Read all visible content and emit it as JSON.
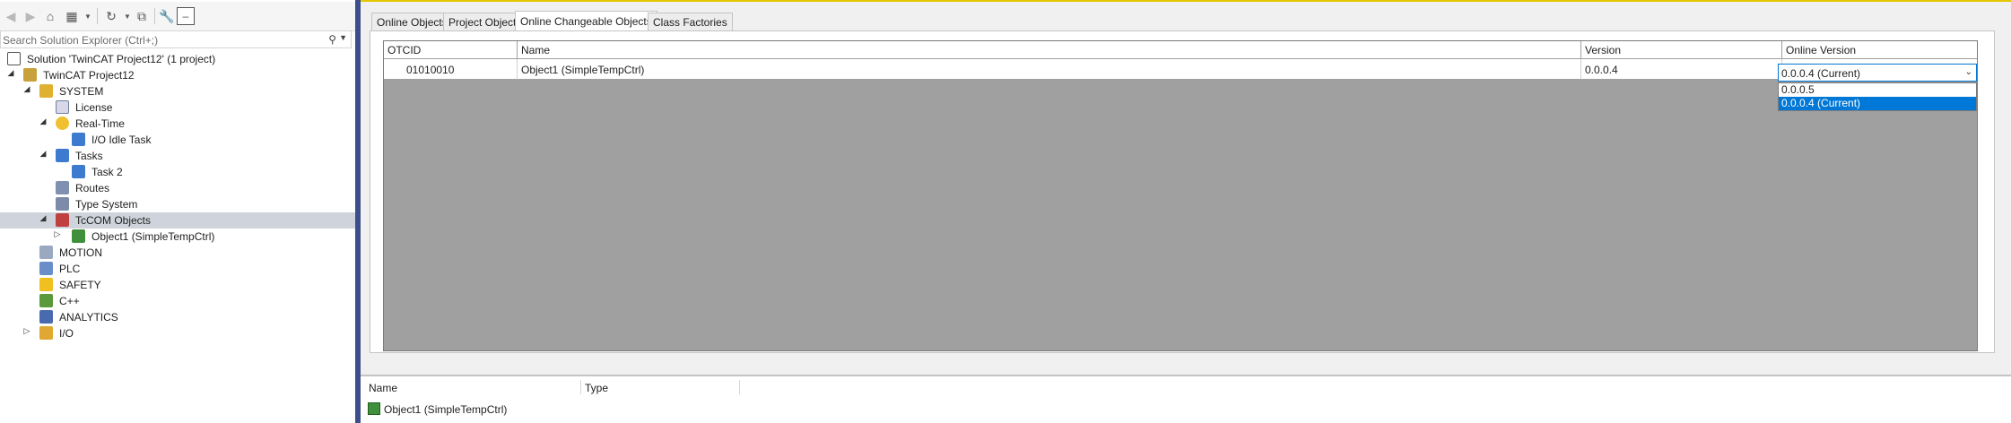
{
  "toolbar": {
    "icons": [
      "back-icon",
      "forward-icon",
      "home-icon",
      "switch-views-icon",
      "history-icon",
      "collapse-all-icon",
      "properties-icon",
      "preview-icon"
    ]
  },
  "search": {
    "placeholder": "Search Solution Explorer (Ctrl+;)"
  },
  "tree": {
    "solution": "Solution 'TwinCAT Project12' (1 project)",
    "project": "TwinCAT Project12",
    "system": "SYSTEM",
    "license": "License",
    "realtime": "Real-Time",
    "io_idle_task": "I/O Idle Task",
    "tasks": "Tasks",
    "task2": "Task 2",
    "routes": "Routes",
    "type_system": "Type System",
    "tccom": "TcCOM Objects",
    "object1": "Object1 (SimpleTempCtrl)",
    "motion": "MOTION",
    "plc": "PLC",
    "safety": "SAFETY",
    "cpp": "C++",
    "analytics": "ANALYTICS",
    "io": "I/O"
  },
  "tabs": {
    "online_objects": "Online Objects",
    "project_objects": "Project Objects",
    "online_changeable": "Online Changeable Objects",
    "class_factories": "Class Factories"
  },
  "grid": {
    "headers": {
      "otcid": "OTCID",
      "name": "Name",
      "version": "Version",
      "online_version": "Online Version"
    },
    "row": {
      "otcid": "01010010",
      "name": "Object1 (SimpleTempCtrl)",
      "version": "0.0.0.4",
      "online_version": "0.0.0.4 (Current)"
    },
    "dropdown_options": [
      "0.0.0.5",
      "0.0.0.4 (Current)"
    ]
  },
  "bottom": {
    "headers": {
      "name": "Name",
      "type": "Type"
    },
    "item": "Object1 (SimpleTempCtrl)"
  },
  "colors": {
    "accent": "#0078d7",
    "splitter": "#3d4f8a",
    "grid_background": "#a0a0a0",
    "selected_row": "#cfd4dc"
  }
}
